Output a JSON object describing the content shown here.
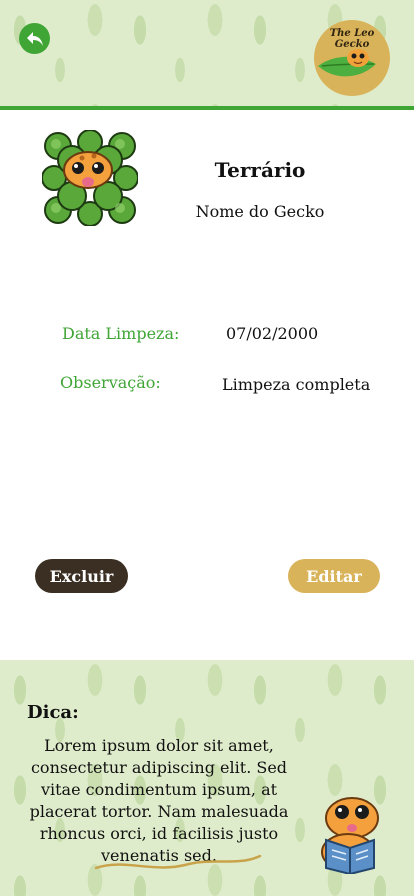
{
  "header": {
    "back_icon": "back-arrow-icon",
    "logo_text": "The Leo\nGecko"
  },
  "detail": {
    "title": "Terrário",
    "gecko_name": "Nome do Gecko",
    "fields": [
      {
        "label": "Data Limpeza:",
        "value": "07/02/2000"
      },
      {
        "label": "Observação:",
        "value": "Limpeza completa"
      }
    ]
  },
  "actions": {
    "delete_label": "Excluir",
    "edit_label": "Editar"
  },
  "tip": {
    "title": "Dica:",
    "text": "Lorem ipsum dolor sit amet, consectetur adipiscing elit. Sed vitae condimentum ipsum, at placerat tortor. Nam malesuada rhoncus orci, id facilisis justo venenatis sed."
  },
  "colors": {
    "accent_green": "#3fa535",
    "delete_button": "#3b2f23",
    "edit_button": "#d9b35a",
    "leaf_background": "#dfeccb"
  }
}
